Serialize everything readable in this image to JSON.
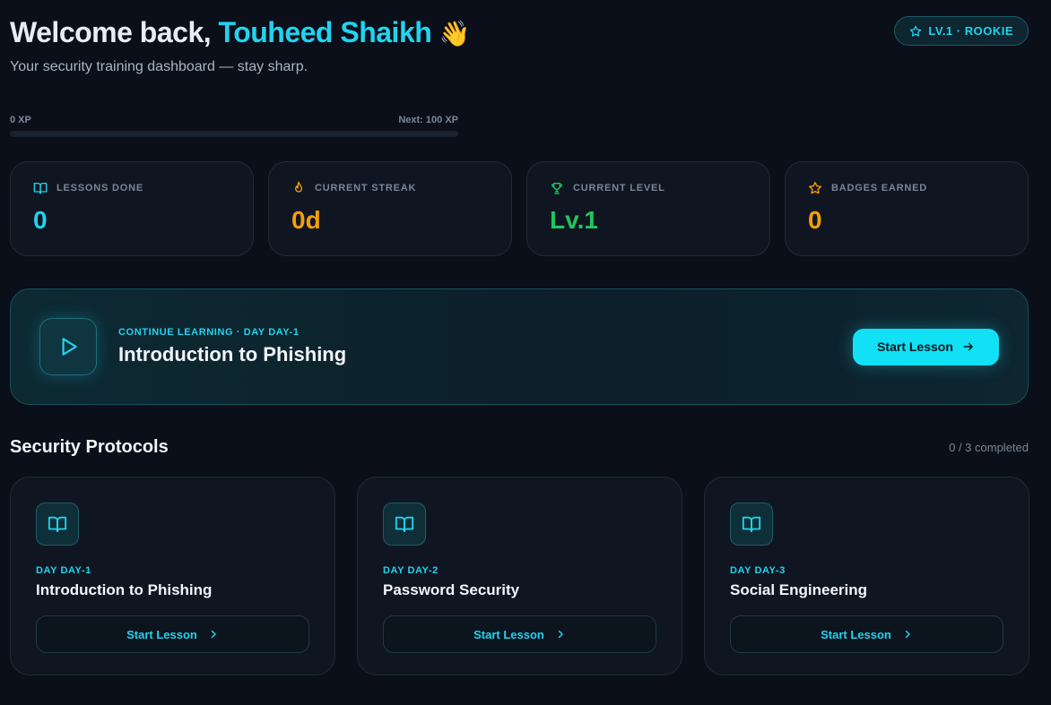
{
  "header": {
    "greeting": "Welcome back, ",
    "user_name": "Touheed Shaikh",
    "wave": "👋",
    "subtitle": "Your security training dashboard — stay sharp.",
    "level_badge": "LV.1 · ROOKIE"
  },
  "xp": {
    "current_label": "0 XP",
    "next_label": "Next: 100 XP",
    "progress_fraction": 0
  },
  "stats": [
    {
      "label": "LESSONS DONE",
      "value": "0",
      "icon": "book-open-icon",
      "color": "#22d3ee"
    },
    {
      "label": "CURRENT STREAK",
      "value": "0d",
      "icon": "flame-icon",
      "color": "#f59e0b"
    },
    {
      "label": "CURRENT LEVEL",
      "value": "Lv.1",
      "icon": "trophy-icon",
      "color": "#22c55e"
    },
    {
      "label": "BADGES EARNED",
      "value": "0",
      "icon": "star-icon",
      "color": "#f5a000"
    }
  ],
  "continue": {
    "kicker": "CONTINUE LEARNING · DAY DAY-1",
    "title": "Introduction to Phishing",
    "button_label": "Start Lesson"
  },
  "protocols": {
    "title": "Security Protocols",
    "count": "0 / 3 completed",
    "lessons": [
      {
        "day": "DAY DAY-1",
        "title": "Introduction to Phishing",
        "button_label": "Start Lesson"
      },
      {
        "day": "DAY DAY-2",
        "title": "Password Security",
        "button_label": "Start Lesson"
      },
      {
        "day": "DAY DAY-3",
        "title": "Social Engineering",
        "button_label": "Start Lesson"
      }
    ]
  },
  "colors": {
    "background": "#0a0f1a",
    "accent": "#22d3ee",
    "streak": "#f59e0b",
    "level": "#22c55e",
    "badges": "#f5a000"
  }
}
